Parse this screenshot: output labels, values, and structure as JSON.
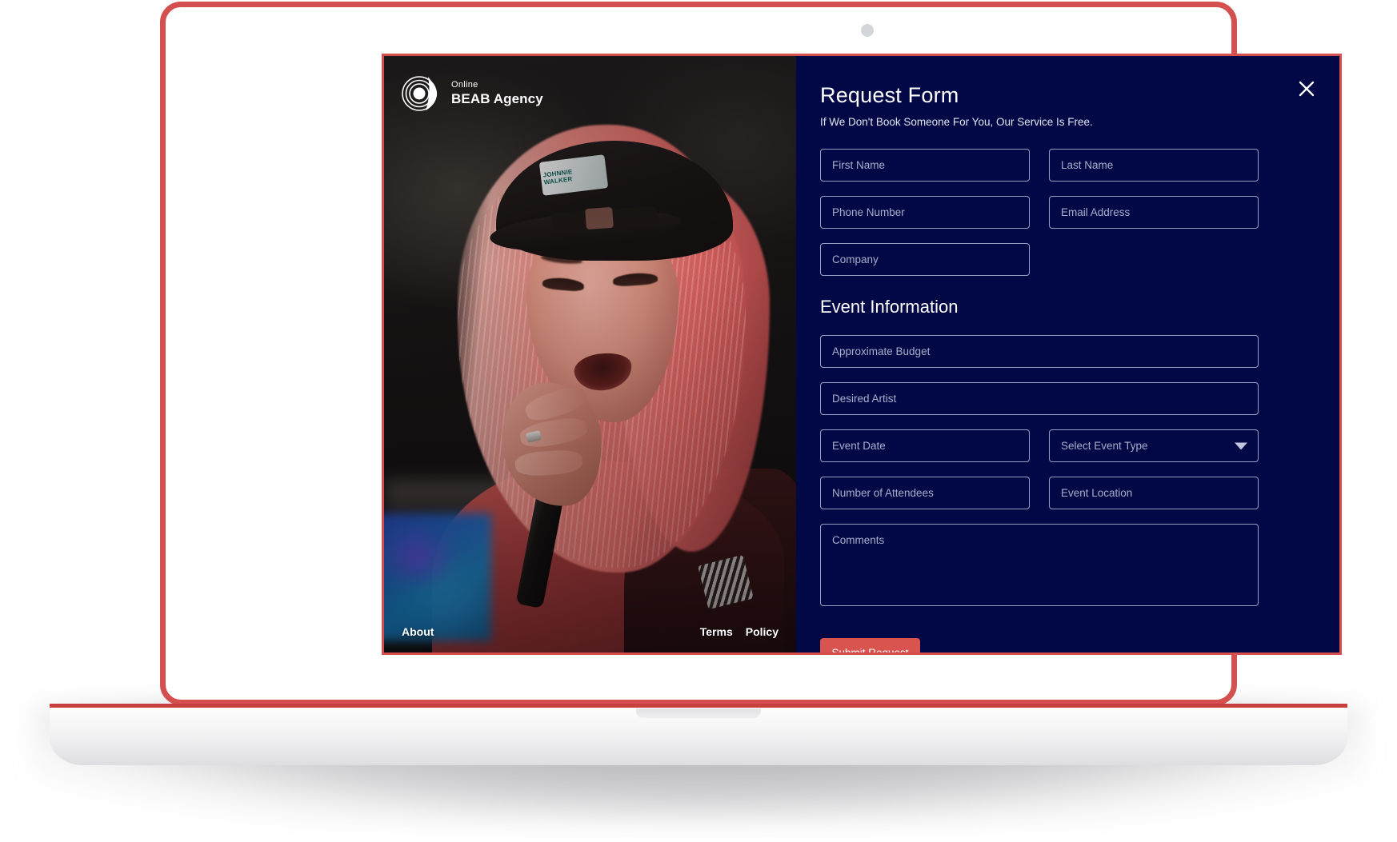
{
  "device": {
    "type": "laptop-mockup",
    "frame_color": "#d4504e",
    "camera_icon": "camera-dot"
  },
  "brand": {
    "logo_icon": "vinyl-record-music-note-logo",
    "sub_label": "Online",
    "title": "BEAB Agency"
  },
  "photo": {
    "alt_description": "Female singer with pink blonde hair wearing a black Johnnie Walker cap holding a microphone",
    "cap_logo_line1": "JOHNNIE",
    "cap_logo_line2": "WALKER"
  },
  "photo_footer": {
    "left_links": [
      {
        "label": "About",
        "name": "footer-link-about"
      }
    ],
    "right_links": [
      {
        "label": "Terms",
        "name": "footer-link-terms"
      },
      {
        "label": "Policy",
        "name": "footer-link-policy"
      }
    ]
  },
  "form": {
    "title": "Request Form",
    "subtitle": "If We Don't Book Someone For You, Our Service Is Free.",
    "close_icon": "close-x-icon",
    "contact_fields": [
      {
        "name": "first-name-input",
        "placeholder": "First Name",
        "value": ""
      },
      {
        "name": "last-name-input",
        "placeholder": "Last Name",
        "value": ""
      },
      {
        "name": "phone-number-input",
        "placeholder": "Phone Number",
        "value": ""
      },
      {
        "name": "email-address-input",
        "placeholder": "Email Address",
        "value": ""
      },
      {
        "name": "company-input",
        "placeholder": "Company",
        "value": ""
      }
    ],
    "section_title": "Event Information",
    "event_fields": {
      "budget": {
        "placeholder": "Approximate Budget",
        "value": ""
      },
      "artist": {
        "placeholder": "Desired Artist",
        "value": ""
      },
      "date": {
        "placeholder": "Event Date",
        "value": ""
      },
      "event_type": {
        "placeholder": "Select Event Type",
        "value": "Select Event Type",
        "caret_icon": "chevron-down-icon"
      },
      "attendees": {
        "placeholder": "Number of Attendees",
        "value": ""
      },
      "location": {
        "placeholder": "Event Location",
        "value": ""
      },
      "comments": {
        "placeholder": "Comments",
        "value": ""
      }
    },
    "submit_label": "Submit Request"
  },
  "colors": {
    "navy": "#020845",
    "accent_red": "#d9534f",
    "frame_red": "#d4504e",
    "field_border": "#9aa0c4",
    "placeholder": "#a9aecb"
  }
}
